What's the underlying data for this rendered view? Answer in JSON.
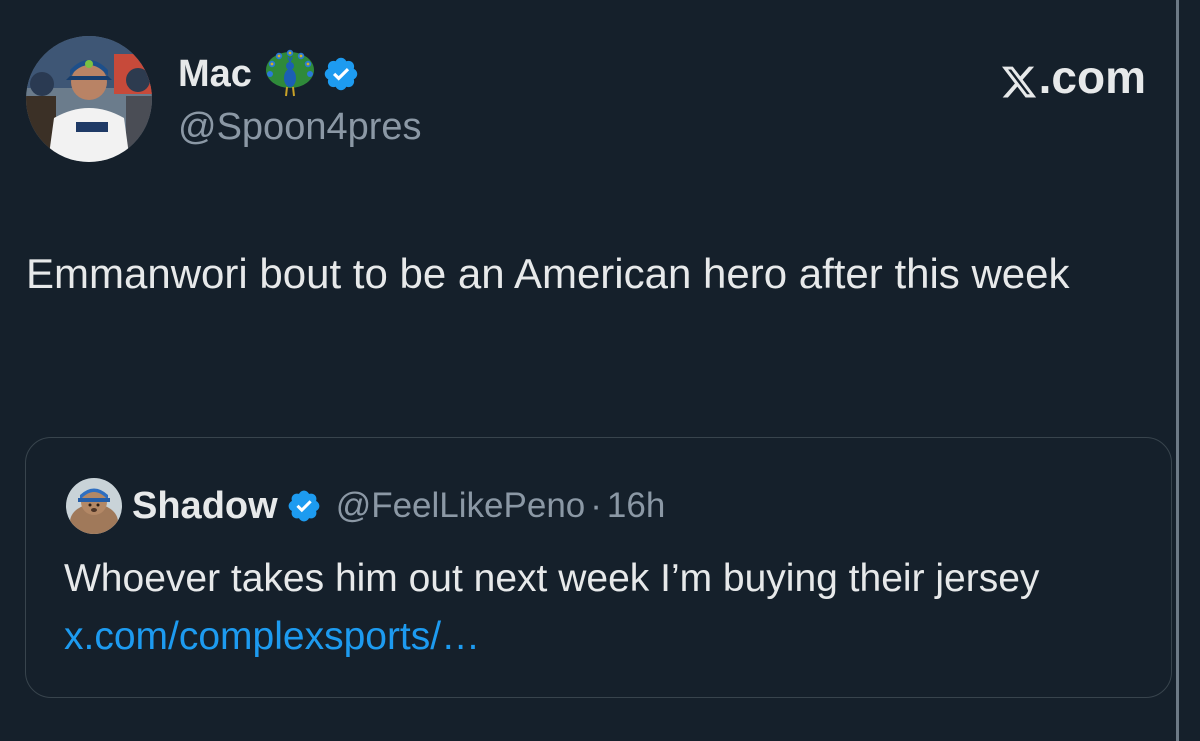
{
  "author": {
    "display_name": "Mac",
    "handle": "@Spoon4pres",
    "name_emoji_icon": "peacock-icon",
    "verified_icon": "verified-badge-icon"
  },
  "site": {
    "logo_icon": "x-logo-icon",
    "label": ".com"
  },
  "tweet": {
    "text": "Emmanwori bout to be an American hero after this week"
  },
  "quoted_tweet": {
    "display_name": "Shadow",
    "handle": "@FeelLikePeno",
    "separator": "·",
    "time": "16h",
    "text": "Whoever takes him out next week I’m buying their jersey ",
    "link_text": "x.com/complexsports/…"
  },
  "colors": {
    "background": "#15202b",
    "text_primary": "#e7e9ea",
    "text_secondary": "#8b98a5",
    "link": "#1d9bf0",
    "verified": "#1d9bf0",
    "border": "#38444d"
  }
}
